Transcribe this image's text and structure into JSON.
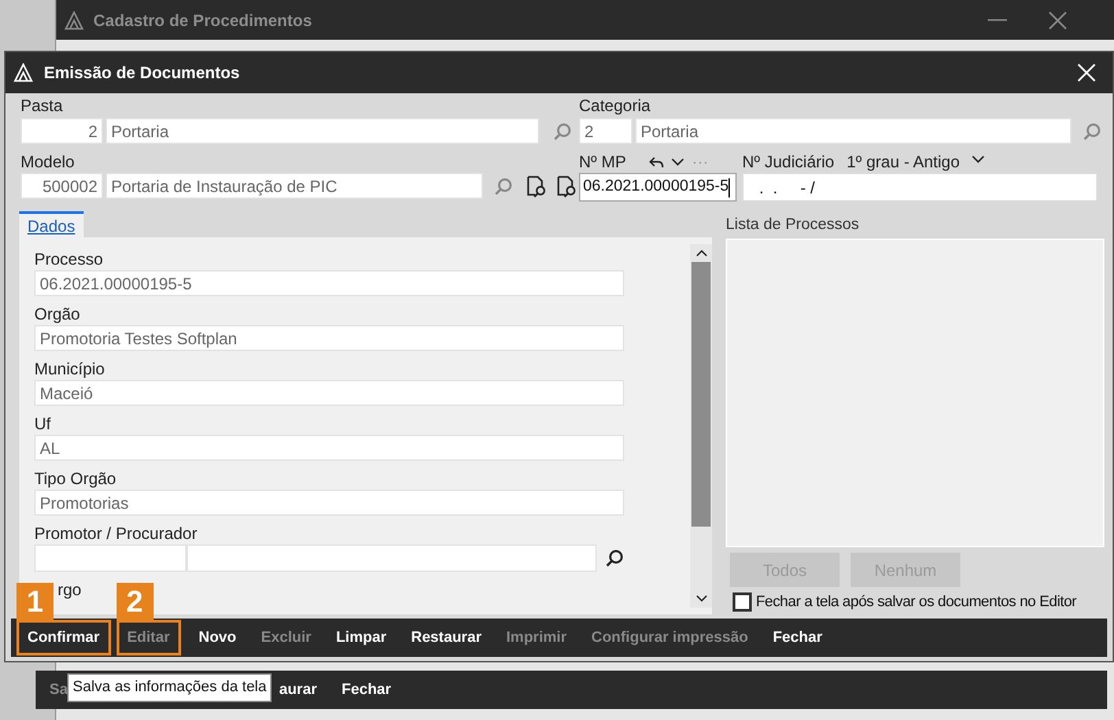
{
  "background_window": {
    "title": "Cadastro de Procedimentos",
    "toolbar": [
      {
        "label": "Sa",
        "disabled": true
      },
      {
        "label": "aurar",
        "disabled": false
      },
      {
        "label": "Fechar",
        "disabled": false
      }
    ]
  },
  "dialog": {
    "title": "Emissão de Documentos",
    "pasta": {
      "label": "Pasta",
      "code": "2",
      "name": "Portaria"
    },
    "categoria": {
      "label": "Categoria",
      "code": "2",
      "name": "Portaria"
    },
    "modelo": {
      "label": "Modelo",
      "code": "500002",
      "name": "Portaria de Instauração de PIC"
    },
    "numero_mp": {
      "label": "Nº MP",
      "ellipsis": "···",
      "value": "06.2021.00000195-5"
    },
    "numero_judiciario": {
      "label": "Nº Judiciário",
      "grau": "1º grau - Antigo",
      "value": " .  .     - /"
    },
    "tabs": [
      {
        "label": "Dados",
        "selected": true
      }
    ],
    "fields": [
      {
        "kind": "text",
        "label": "Processo",
        "value": "06.2021.00000195-5"
      },
      {
        "kind": "text",
        "label": "Orgão",
        "value": "Promotoria Testes Softplan"
      },
      {
        "kind": "text",
        "label": "Município",
        "value": "Maceió"
      },
      {
        "kind": "text",
        "label": "Uf",
        "value": "AL"
      },
      {
        "kind": "text",
        "label": "Tipo Orgão",
        "value": "Promotorias"
      },
      {
        "kind": "lookup",
        "label": "Promotor / Procurador"
      },
      {
        "kind": "partial",
        "label": "rgo"
      }
    ],
    "process_list": {
      "title": "Lista de Processos",
      "buttons": [
        {
          "label": "Todos",
          "disabled": true
        },
        {
          "label": "Nenhum",
          "disabled": true
        }
      ],
      "close_after_save": {
        "label": "Fechar a tela após salvar os documentos no Editor",
        "checked": false
      }
    },
    "toolbar": [
      {
        "label": "Confirmar",
        "disabled": false,
        "callout": "1"
      },
      {
        "label": "Editar",
        "disabled": true,
        "callout": "2"
      },
      {
        "label": "Novo",
        "disabled": false
      },
      {
        "label": "Excluir",
        "disabled": true
      },
      {
        "label": "Limpar",
        "disabled": false
      },
      {
        "label": "Restaurar",
        "disabled": false
      },
      {
        "label": "Imprimir",
        "disabled": true
      },
      {
        "label": "Configurar impressão",
        "disabled": true
      },
      {
        "label": "Fechar",
        "disabled": false
      }
    ]
  },
  "tooltip": "Salva as informações da tela"
}
